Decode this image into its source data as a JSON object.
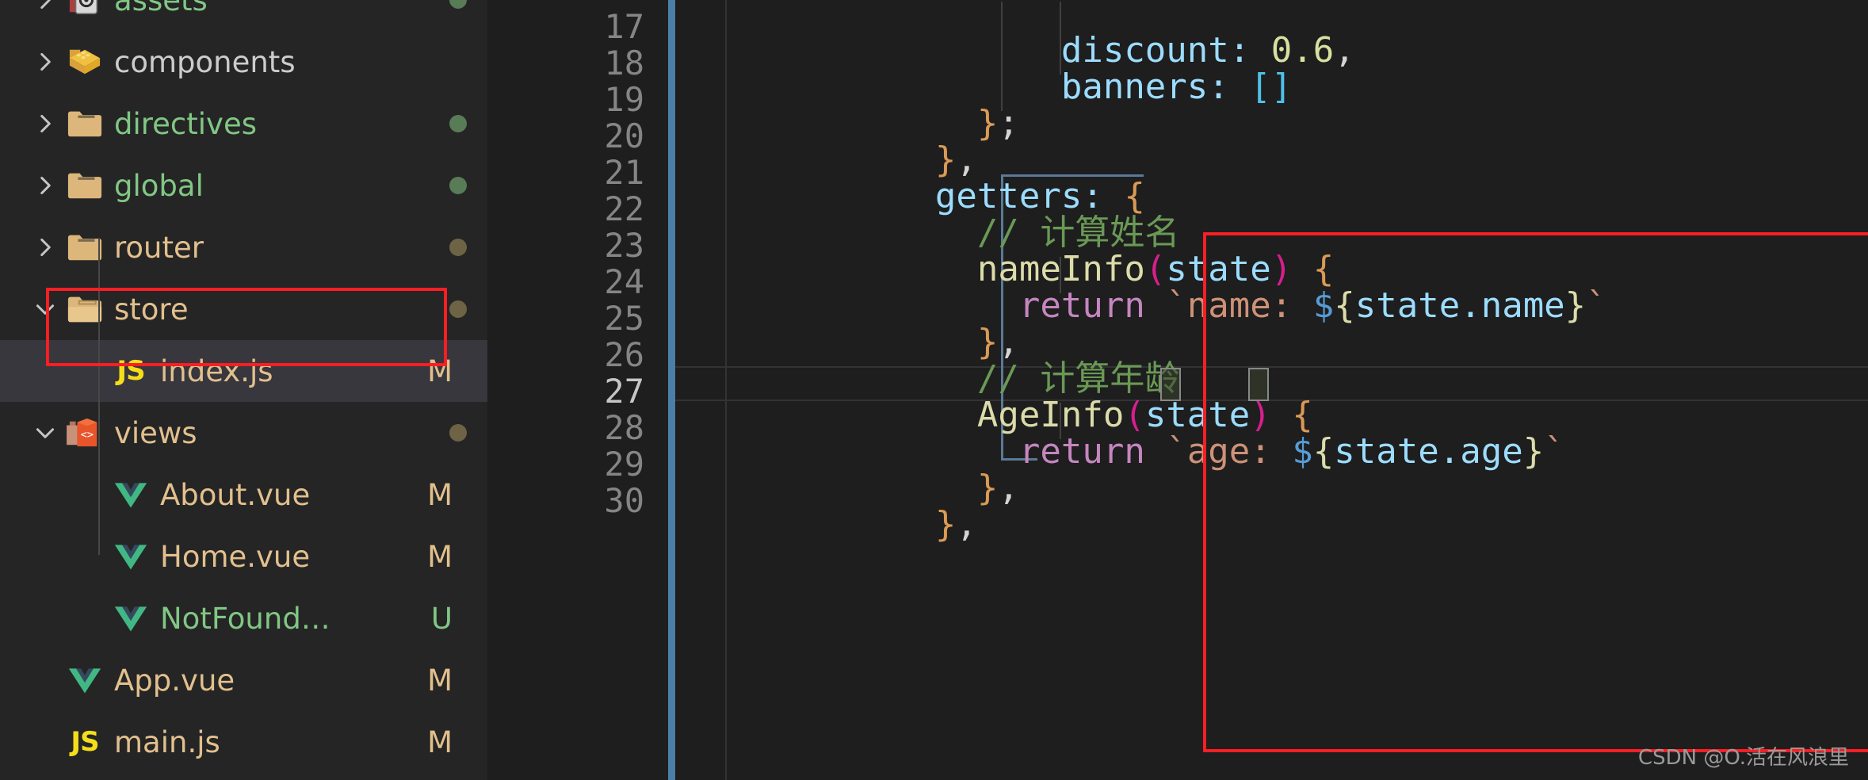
{
  "sidebar": {
    "background": "#252526",
    "selected_background": "#37373d",
    "items": [
      {
        "name": "assets",
        "kind": "folder",
        "icon": "folder-assets-icon",
        "expanded": false,
        "chevron": "chevron-right-icon",
        "indent": 1,
        "git_letter": "",
        "git_color": "",
        "dot_color": "#587c56",
        "label_color": "#81c784",
        "selected": false
      },
      {
        "name": "components",
        "kind": "folder",
        "icon": "folder-components-icon",
        "expanded": false,
        "chevron": "chevron-right-icon",
        "indent": 1,
        "git_letter": "",
        "git_color": "",
        "dot_color": "",
        "label_color": "#cccccc",
        "selected": false
      },
      {
        "name": "directives",
        "kind": "folder",
        "icon": "folder-icon",
        "expanded": false,
        "chevron": "chevron-right-icon",
        "indent": 1,
        "git_letter": "",
        "git_color": "",
        "dot_color": "#587c56",
        "label_color": "#81c784",
        "selected": false
      },
      {
        "name": "global",
        "kind": "folder",
        "icon": "folder-icon",
        "expanded": false,
        "chevron": "chevron-right-icon",
        "indent": 1,
        "git_letter": "",
        "git_color": "",
        "dot_color": "#587c56",
        "label_color": "#81c784",
        "selected": false
      },
      {
        "name": "router",
        "kind": "folder",
        "icon": "folder-icon",
        "expanded": false,
        "chevron": "chevron-right-icon",
        "indent": 1,
        "git_letter": "",
        "git_color": "",
        "dot_color": "#6e6344",
        "label_color": "#e2c08d",
        "selected": false
      },
      {
        "name": "store",
        "kind": "folder",
        "icon": "folder-open-icon",
        "expanded": true,
        "chevron": "chevron-down-icon",
        "indent": 1,
        "git_letter": "",
        "git_color": "",
        "dot_color": "#6e6344",
        "label_color": "#e2c08d",
        "selected": false
      },
      {
        "name": "index.js",
        "kind": "file",
        "icon": "js-file-icon",
        "expanded": null,
        "chevron": "",
        "indent": 2,
        "git_letter": "M",
        "git_color": "#e2c08d",
        "dot_color": "",
        "label_color": "#e2c08d",
        "selected": true
      },
      {
        "name": "views",
        "kind": "folder",
        "icon": "folder-views-icon",
        "expanded": true,
        "chevron": "chevron-down-icon",
        "indent": 1,
        "git_letter": "",
        "git_color": "",
        "dot_color": "#6e6344",
        "label_color": "#e2c08d",
        "selected": false
      },
      {
        "name": "About.vue",
        "kind": "file",
        "icon": "vue-file-icon",
        "expanded": null,
        "chevron": "",
        "indent": 2,
        "git_letter": "M",
        "git_color": "#e2c08d",
        "dot_color": "",
        "label_color": "#e2c08d",
        "selected": false
      },
      {
        "name": "Home.vue",
        "kind": "file",
        "icon": "vue-file-icon",
        "expanded": null,
        "chevron": "",
        "indent": 2,
        "git_letter": "M",
        "git_color": "#e2c08d",
        "dot_color": "",
        "label_color": "#e2c08d",
        "selected": false
      },
      {
        "name": "NotFound…",
        "kind": "file",
        "icon": "vue-file-icon",
        "expanded": null,
        "chevron": "",
        "indent": 2,
        "git_letter": "U",
        "git_color": "#81c784",
        "dot_color": "",
        "label_color": "#81c784",
        "selected": false
      },
      {
        "name": "App.vue",
        "kind": "file",
        "icon": "vue-file-icon",
        "expanded": null,
        "chevron": "",
        "indent": 1,
        "git_letter": "M",
        "git_color": "#e2c08d",
        "dot_color": "",
        "label_color": "#e2c08d",
        "selected": false
      },
      {
        "name": "main.js",
        "kind": "file",
        "icon": "js-file-icon",
        "expanded": null,
        "chevron": "",
        "indent": 1,
        "git_letter": "M",
        "git_color": "#e2c08d",
        "dot_color": "",
        "label_color": "#e2c08d",
        "selected": false
      }
    ],
    "annotation_box_color": "#fb1e23"
  },
  "editor": {
    "active_line": 27,
    "first_visible_line": 17,
    "line_numbers": [
      "17",
      "18",
      "19",
      "20",
      "21",
      "22",
      "23",
      "24",
      "25",
      "26",
      "27",
      "28",
      "29",
      "30"
    ],
    "modified_bar_color": "#4b7fa5",
    "annotation_box_color": "#fb1e23",
    "lines": {
      "l17": {
        "indent": "        ",
        "text": "discount: 0.6,"
      },
      "l18": {
        "indent": "        ",
        "text": "banners: []"
      },
      "l19": {
        "indent": "    ",
        "text": "};"
      },
      "l20": {
        "indent": "  ",
        "text": "},"
      },
      "l21": {
        "indent": "  ",
        "text": "getters: {"
      },
      "l22": {
        "indent": "    ",
        "text": "// 计算姓名"
      },
      "l23": {
        "indent": "    ",
        "text": "nameInfo(state) {"
      },
      "l24": {
        "indent": "      ",
        "text": "return `name: ${state.name}`"
      },
      "l25": {
        "indent": "    ",
        "text": "},"
      },
      "l26": {
        "indent": "    ",
        "text": "// 计算年龄"
      },
      "l27": {
        "indent": "    ",
        "text": "AgeInfo(state) {"
      },
      "l28": {
        "indent": "      ",
        "text": "return `age: ${state.age}`"
      },
      "l29": {
        "indent": "    ",
        "text": "},"
      },
      "l30": {
        "indent": "  ",
        "text": "},"
      }
    },
    "tokens": {
      "discount_key": "discount:",
      "discount_val": "0.6",
      "banners_key": "banners:",
      "banners_val": "[]",
      "comma": ",",
      "semicolon": ";",
      "close_brace": "}",
      "getters_key": "getters:",
      "open_brace": "{",
      "comment_name": "// 计算姓名",
      "comment_age": "// 计算年龄",
      "fn_nameInfo": "nameInfo",
      "fn_AgeInfo": "AgeInfo",
      "paren_open": "(",
      "paren_close": ")",
      "param_state": "state",
      "kw_return": "return",
      "tpl_name_open": "`name: ",
      "tpl_age_open": "`age: ",
      "dollar": "$",
      "curly_open": "{",
      "curly_close": "}",
      "expr_state_name": "state.name",
      "expr_state_age": "state.age",
      "backtick": "`"
    }
  },
  "watermark": {
    "text": "CSDN @O.活在风浪里"
  }
}
